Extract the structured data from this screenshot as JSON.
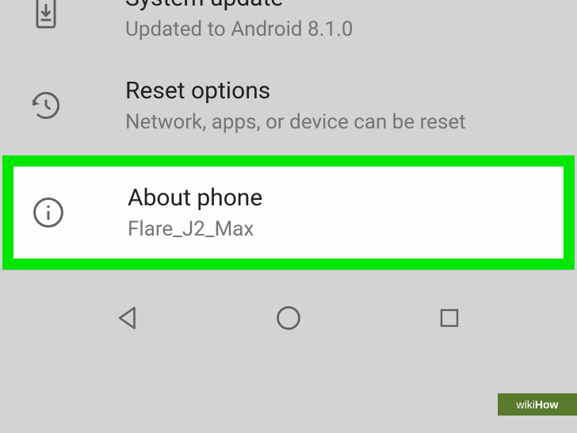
{
  "settings": {
    "system_update": {
      "title": "System update",
      "subtitle": "Updated to Android 8.1.0"
    },
    "reset_options": {
      "title": "Reset options",
      "subtitle": "Network, apps, or device can be reset"
    },
    "about_phone": {
      "title": "About phone",
      "subtitle": "Flare_J2_Max"
    }
  },
  "watermark": {
    "prefix": "wiki",
    "suffix": "How"
  }
}
